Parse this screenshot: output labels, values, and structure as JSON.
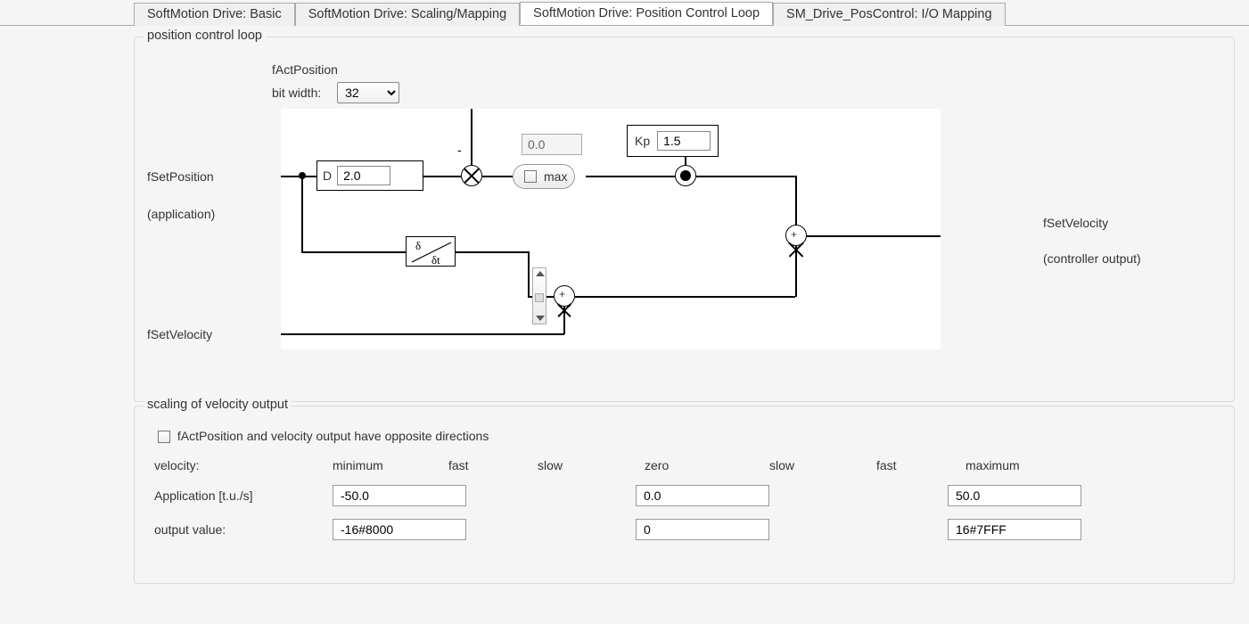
{
  "tabs": {
    "t0": "SoftMotion Drive: Basic",
    "t1": "SoftMotion Drive: Scaling/Mapping",
    "t2": "SoftMotion Drive: Position Control Loop",
    "t3": "SM_Drive_PosControl: I/O Mapping"
  },
  "group_pcl": {
    "legend": "position control loop",
    "fActPosition": "fActPosition",
    "bit_width_label": "bit width:",
    "bit_width_value": "32",
    "fSetPosition": "fSetPosition",
    "application": "(application)",
    "fSetVelocity_in": "fSetVelocity",
    "D_label": "D",
    "D_value": "2.0",
    "dead_value": "0.0",
    "max_label": "max",
    "Kp_label": "Kp",
    "Kp_value": "1.5",
    "fSetVelocity_out": "fSetVelocity",
    "controller_output": "(controller output)",
    "minus_sign": "-"
  },
  "group_scale": {
    "legend": "scaling of velocity output",
    "opposite_label": "fActPosition and velocity output have opposite directions",
    "velocity": "velocity:",
    "minimum": "minimum",
    "fast1": "fast",
    "slow1": "slow",
    "zero": "zero",
    "slow2": "slow",
    "fast2": "fast",
    "maximum": "maximum",
    "app_label": "Application [t.u./s]",
    "app_min": "-50.0",
    "app_zero": "0.0",
    "app_max": "50.0",
    "out_label": "output value:",
    "out_min": "-16#8000",
    "out_zero": "0",
    "out_max": "16#7FFF"
  }
}
